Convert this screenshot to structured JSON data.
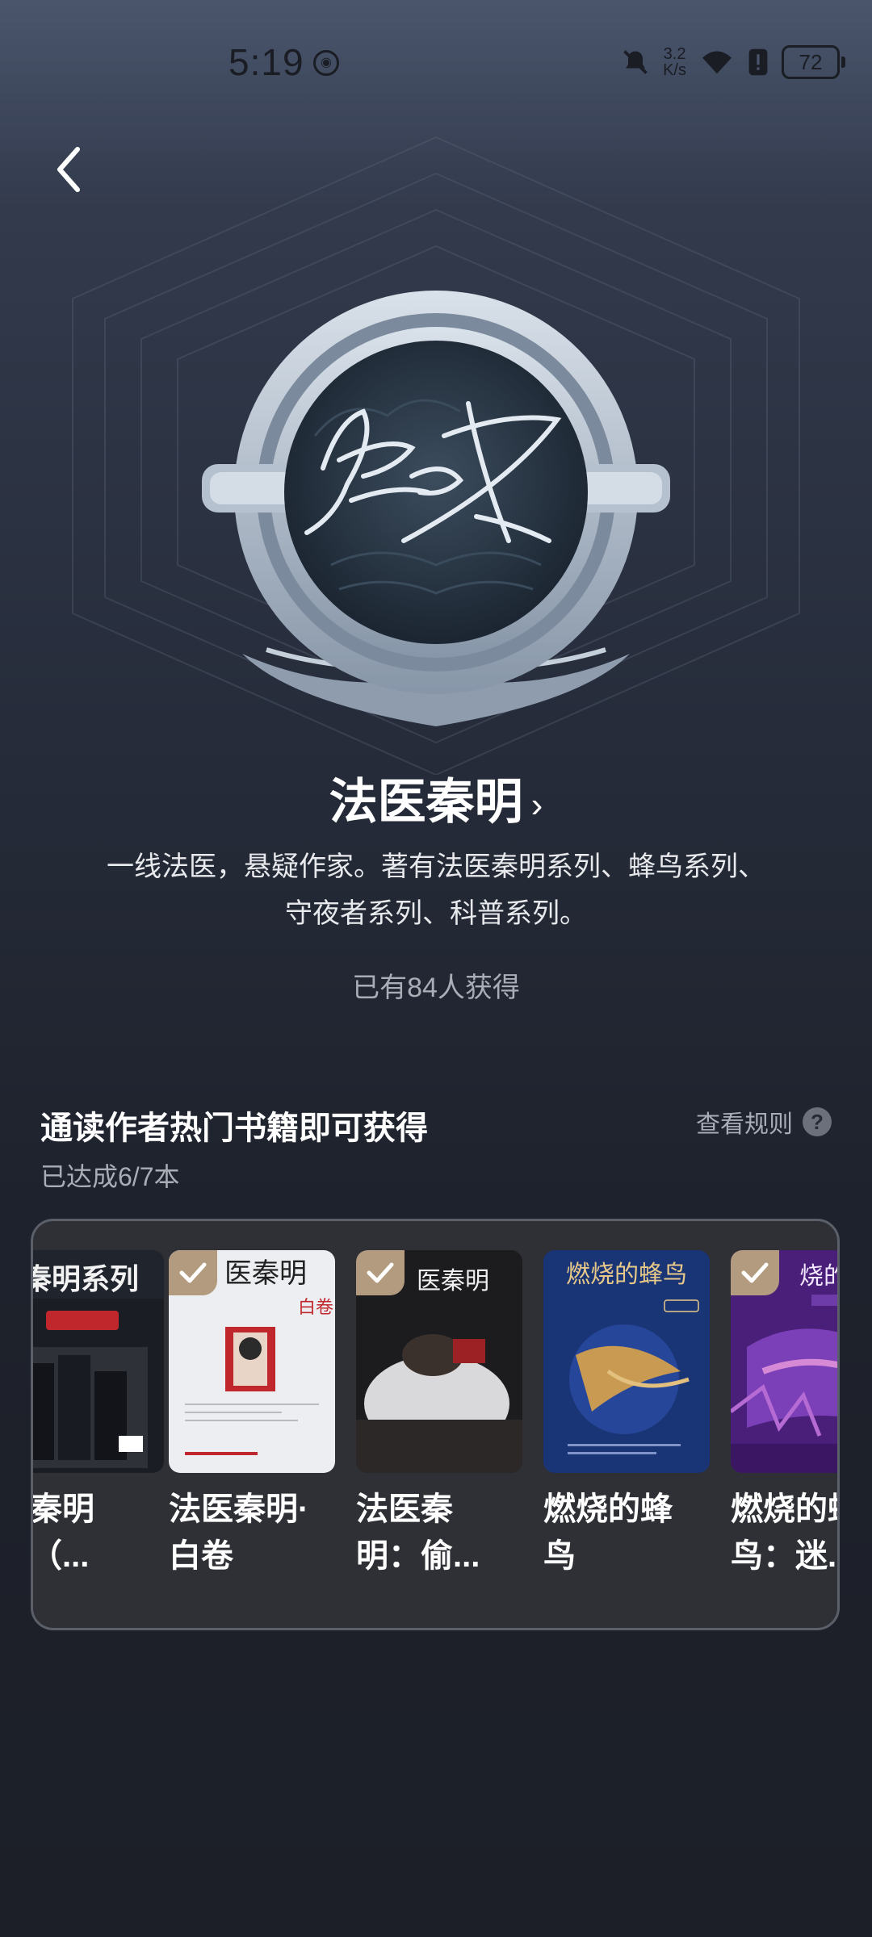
{
  "status_bar": {
    "time": "5:19",
    "net_speed_value": "3.2",
    "net_speed_unit": "K/s",
    "battery": "72"
  },
  "author": {
    "name": "法医秦明",
    "chevron": "›",
    "description_line1": "一线法医，悬疑作家。著有法医秦明系列、蜂鸟系列、",
    "description_line2": "守夜者系列、科普系列。",
    "earned_count_text": "已有84人获得"
  },
  "task": {
    "title": "通读作者热门书籍即可获得",
    "rules_link": "查看规则",
    "progress": "已达成6/7本"
  },
  "books": [
    {
      "title": "法医秦明系列（...",
      "title_visible": "医秦明\n列（...",
      "cover_text": "秦明系列",
      "completed": false
    },
    {
      "title": "法医秦明·白卷",
      "cover_text": "医秦明",
      "cover_sub": "白卷",
      "completed": true
    },
    {
      "title": "法医秦明：偷...",
      "cover_text": "医秦明",
      "completed": true
    },
    {
      "title": "燃烧的蜂鸟",
      "cover_text": "燃烧的蜂鸟",
      "completed": false
    },
    {
      "title": "燃烧的蜂鸟：迷...",
      "cover_text": "烧的蜂",
      "completed": true
    }
  ],
  "icons": {
    "back": "chevron-left-icon",
    "help": "question-mark-icon",
    "check": "checkmark-icon"
  }
}
